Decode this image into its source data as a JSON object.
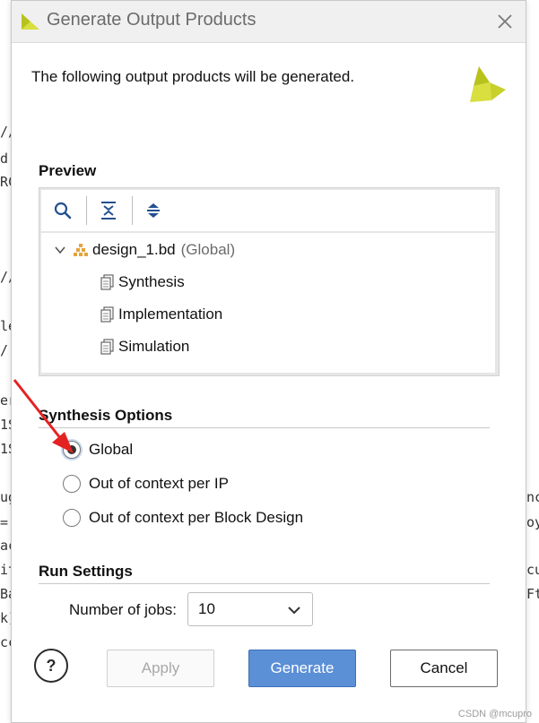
{
  "background_code": [
    "//",
    "d",
    "RC",
    "//",
    "le",
    "/",
    "er",
    "1S",
    "1S",
    "ug",
    "=",
    "ac",
    "it",
    "Ba",
    "k]",
    "cc",
    "nc",
    "oy",
    "cu",
    "Ft"
  ],
  "dialog": {
    "title": "Generate Output Products",
    "header_text": "The following output products will be generated.",
    "colors": {
      "logo_yellow": "#b8c21c",
      "primary_button": "#5b8fd6"
    }
  },
  "preview": {
    "section_label": "Preview",
    "toolbar": {
      "search_icon": "search-icon",
      "collapse_all_icon": "collapse-all-icon",
      "expand_all_icon": "expand-all-icon"
    },
    "tree": {
      "root": {
        "label": "design_1.bd",
        "suffix": "(Global)"
      },
      "children": [
        {
          "label": "Synthesis"
        },
        {
          "label": "Implementation"
        },
        {
          "label": "Simulation"
        }
      ]
    }
  },
  "synthesis_options": {
    "section_label": "Synthesis Options",
    "options": [
      {
        "label": "Global",
        "selected": true
      },
      {
        "label": "Out of context per IP",
        "selected": false
      },
      {
        "label": "Out of context per Block Design",
        "selected": false
      }
    ]
  },
  "run_settings": {
    "section_label": "Run Settings",
    "jobs_label": "Number of jobs:",
    "jobs_value": "10"
  },
  "buttons": {
    "help": "?",
    "apply": "Apply",
    "generate": "Generate",
    "cancel": "Cancel"
  },
  "watermark": "CSDN @mcupro"
}
